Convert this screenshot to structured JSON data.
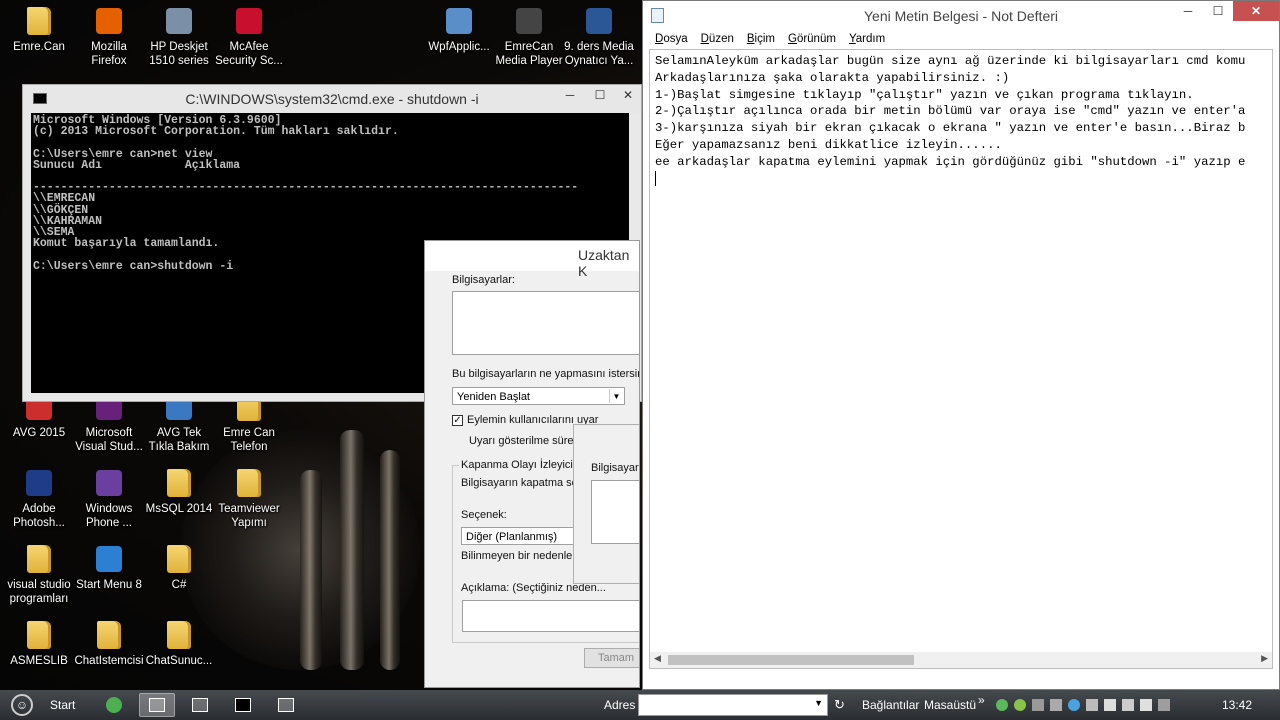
{
  "desktop": {
    "icons": [
      {
        "label": "Emre.Can",
        "kind": "folder"
      },
      {
        "label": "Mozilla\nFirefox",
        "kind": "app",
        "color": "#e66000"
      },
      {
        "label": "HP Deskjet\n1510 series",
        "kind": "app",
        "color": "#7b8fa6"
      },
      {
        "label": "McAfee\nSecurity Sc...",
        "kind": "app",
        "color": "#c8102e"
      },
      {
        "label": "WpfApplic...",
        "kind": "app",
        "color": "#5a8ec9"
      },
      {
        "label": "EmreCan\nMedia Player",
        "kind": "app",
        "color": "#444444"
      },
      {
        "label": "9. ders Media\nOynatıcı Ya...",
        "kind": "app",
        "color": "#2b5797"
      },
      {
        "label": "AVG 2015",
        "kind": "app",
        "color": "#cc2e2e"
      },
      {
        "label": "Microsoft\nVisual Stud...",
        "kind": "app",
        "color": "#68217a"
      },
      {
        "label": "AVG Tek\nTıkla Bakım",
        "kind": "app",
        "color": "#3a78c2"
      },
      {
        "label": "Emre Can\nTelefon",
        "kind": "folder"
      },
      {
        "label": "Adobe\nPhotosh...",
        "kind": "app",
        "color": "#1f3c88"
      },
      {
        "label": "Windows\nPhone ...",
        "kind": "app",
        "color": "#6b3fa0"
      },
      {
        "label": "MsSQL 2014",
        "kind": "folder"
      },
      {
        "label": "Teamviewer\nYapımı",
        "kind": "folder"
      },
      {
        "label": "visual studio\nprogramları",
        "kind": "folder"
      },
      {
        "label": "Start Menu 8",
        "kind": "app",
        "color": "#2d7fd1"
      },
      {
        "label": "C#",
        "kind": "folder"
      },
      {
        "label": "ASMESLIB",
        "kind": "folder"
      },
      {
        "label": "ChatIstemcisi",
        "kind": "folder"
      },
      {
        "label": "ChatSunuc...",
        "kind": "folder"
      }
    ]
  },
  "cmd": {
    "title": "C:\\WINDOWS\\system32\\cmd.exe - shutdown  -i",
    "lines": [
      "Microsoft Windows [Version 6.3.9600]",
      "(c) 2013 Microsoft Corporation. Tüm hakları saklıdır.",
      "",
      "C:\\Users\\emre can>net view",
      "Sunucu Adı            Açıklama",
      "",
      "-------------------------------------------------------------------------------",
      "\\\\EMRECAN",
      "\\\\GÖKÇEN",
      "\\\\KAHRAMAN",
      "\\\\SEMA",
      "Komut başarıyla tamamlandı.",
      "",
      "C:\\Users\\emre can>shutdown -i"
    ]
  },
  "shutdown_dialog": {
    "title": "Uzaktan K",
    "computers_label": "Bilgisayarlar:",
    "action_label": "Bu bilgisayarların ne yapmasını istersiniz:",
    "action_value": "Yeniden Başlat",
    "warn_checkbox_label": "Eylemin kullanıcılarını uyar",
    "warn_time_label": "Uyarı gösterilme süresi:",
    "tracker_group_label": "Kapanma Olayı İzleyicisi",
    "tracker_reason_label": "Bilgisayarın kapatma sebeb",
    "option_label": "Seçenek:",
    "option_value": "Diğer (Planlanmış)",
    "unknown_reason_text": "Bilinmeyen bir nedenle ka",
    "comment_label": "Açıklama: (Seçtiğiniz neden...",
    "ok_button": "Tamam",
    "sub_dialog_label": "Bilgisayar A"
  },
  "notepad": {
    "title": "Yeni Metin Belgesi - Not Defteri",
    "menu": [
      "Dosya",
      "Düzen",
      "Biçim",
      "Görünüm",
      "Yardım"
    ],
    "lines": [
      "SelamınAleyküm arkadaşlar bugün size aynı ağ üzerinde ki bilgisayarları cmd komu",
      "Arkadaşlarınıza şaka olarakta yapabilirsiniz. :)",
      "1-)Başlat simgesine tıklayıp \"çalıştır\" yazın ve çıkan programa tıklayın.",
      "2-)Çalıştır açılınca orada bir metin bölümü var oraya ise \"cmd\" yazın ve enter'a",
      "3-)karşınıza siyah bir ekran çıkacak o ekrana \" yazın ve enter'e basın...Biraz b",
      "Eğer yapamazsanız beni dikkatlice izleyin......",
      "ee arkadaşlar kapatma eylemini yapmak için gördüğünüz gibi \"shutdown -i\" yazıp e"
    ]
  },
  "taskbar": {
    "start_label": "Start",
    "address_label": "Adres",
    "links_label": "Bağlantılar",
    "desktop_label": "Masaüstü",
    "chevron": "»",
    "clock": "13:42"
  }
}
